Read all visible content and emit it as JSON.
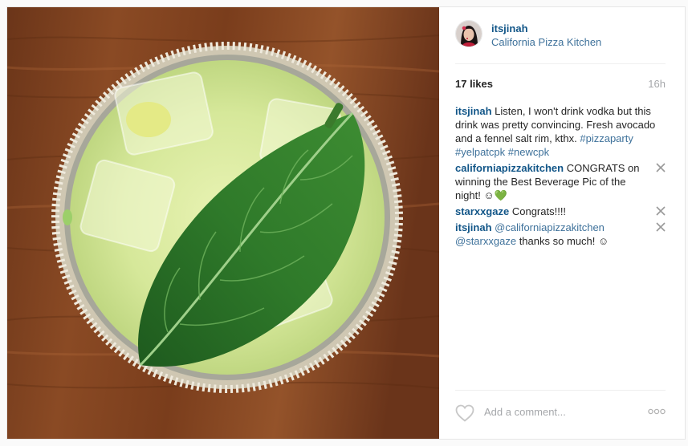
{
  "post": {
    "author": "itsjinah",
    "location": "California Pizza Kitchen",
    "likes": "17 likes",
    "time": "16h"
  },
  "comments": [
    {
      "user": "itsjinah",
      "text": "Listen, I won't drink vodka but this drink was pretty convincing. Fresh avocado and a fennel salt rim, kthx.",
      "tags": [
        "#pizzaparty",
        "#yelpatcpk",
        "#newcpk"
      ]
    },
    {
      "user": "californiapizzakitchen",
      "text": "CONGRATS on winning the Best Beverage Pic of the night! ☺💚"
    },
    {
      "user": "starxxgaze",
      "text": "Congrats!!!!"
    },
    {
      "user": "itsjinah",
      "mention1": "@californiapizzakitchen",
      "mention2": "@starxxgaze",
      "text": "thanks so much! ☺"
    }
  ],
  "footer": {
    "comment_placeholder": "Add a comment..."
  },
  "icons": {
    "heart": "heart-outline-icon",
    "more": "ellipsis-icon",
    "remove": "close-x-icon"
  },
  "colors": {
    "username": "#125688",
    "link": "#3f729b",
    "muted": "#a5a7aa",
    "text": "#262626"
  }
}
